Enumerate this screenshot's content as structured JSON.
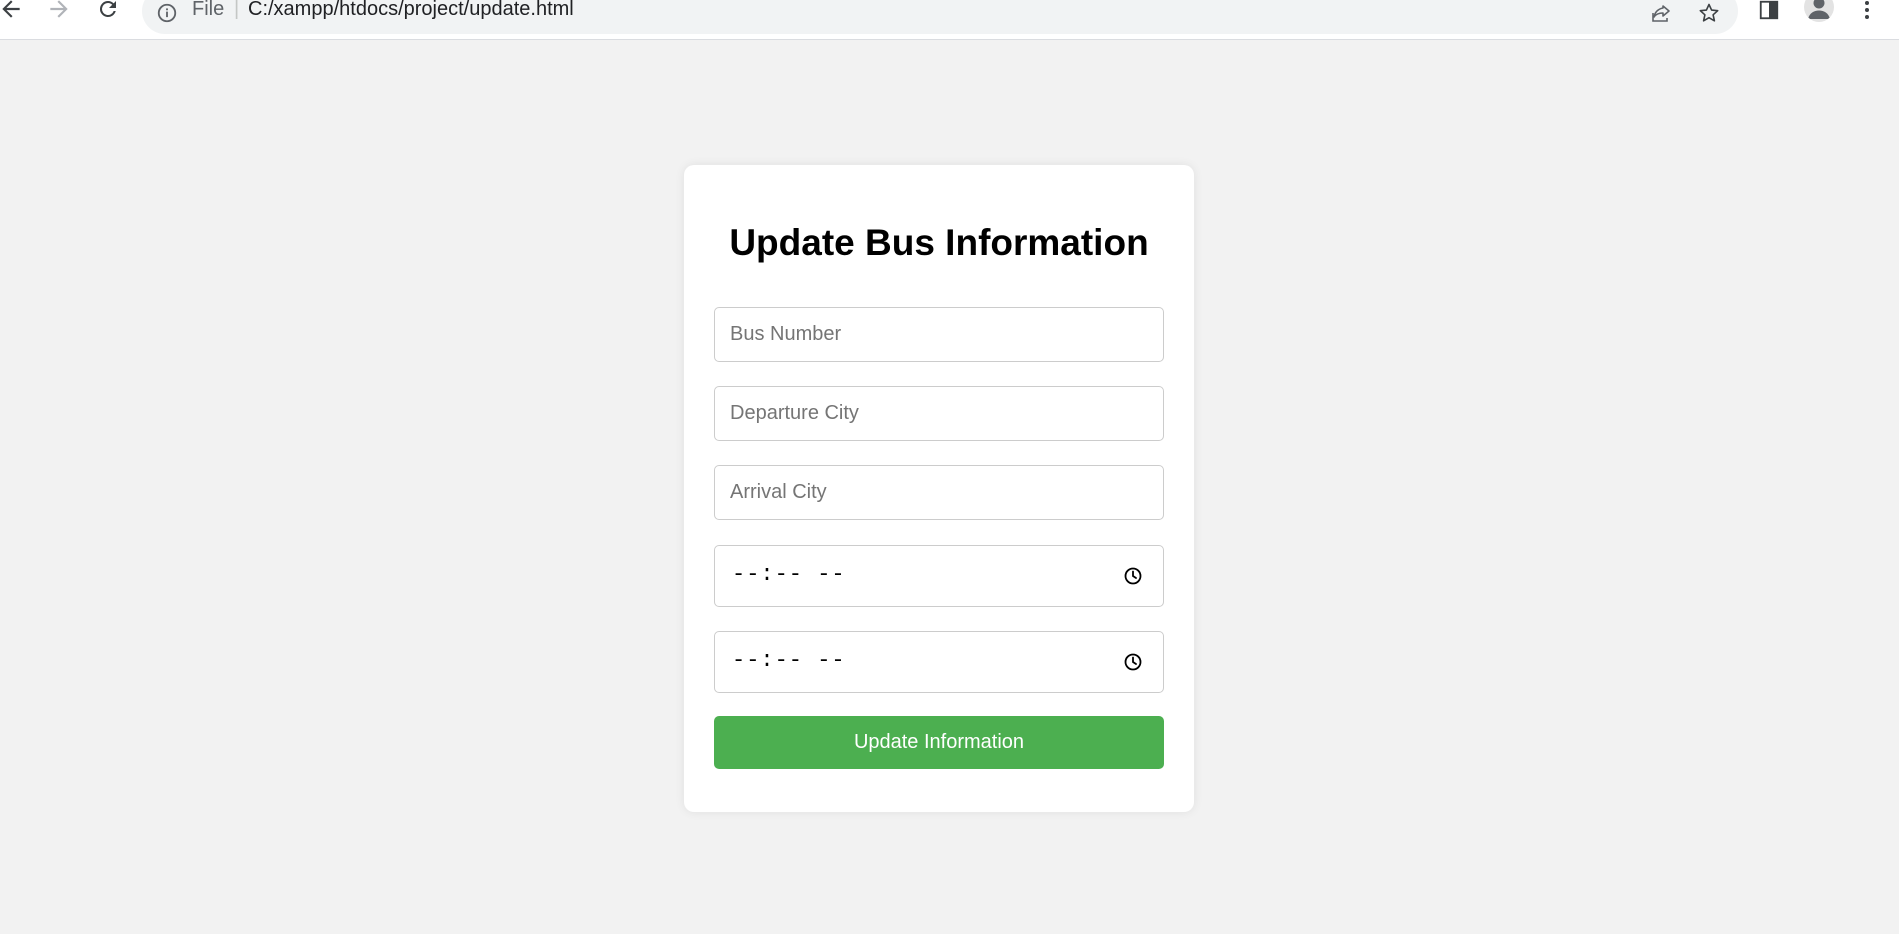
{
  "browser": {
    "address_scheme": "File",
    "address_separator": "|",
    "url": "C:/xampp/htdocs/project/update.html"
  },
  "form": {
    "title": "Update Bus Information",
    "bus_number_placeholder": "Bus Number",
    "departure_city_placeholder": "Departure City",
    "arrival_city_placeholder": "Arrival City",
    "departure_time_display": "--:-- --",
    "arrival_time_display": "--:-- --",
    "submit_label": "Update Information"
  },
  "colors": {
    "page_background": "#f2f2f2",
    "card_background": "#ffffff",
    "button_green": "#4caf50"
  }
}
